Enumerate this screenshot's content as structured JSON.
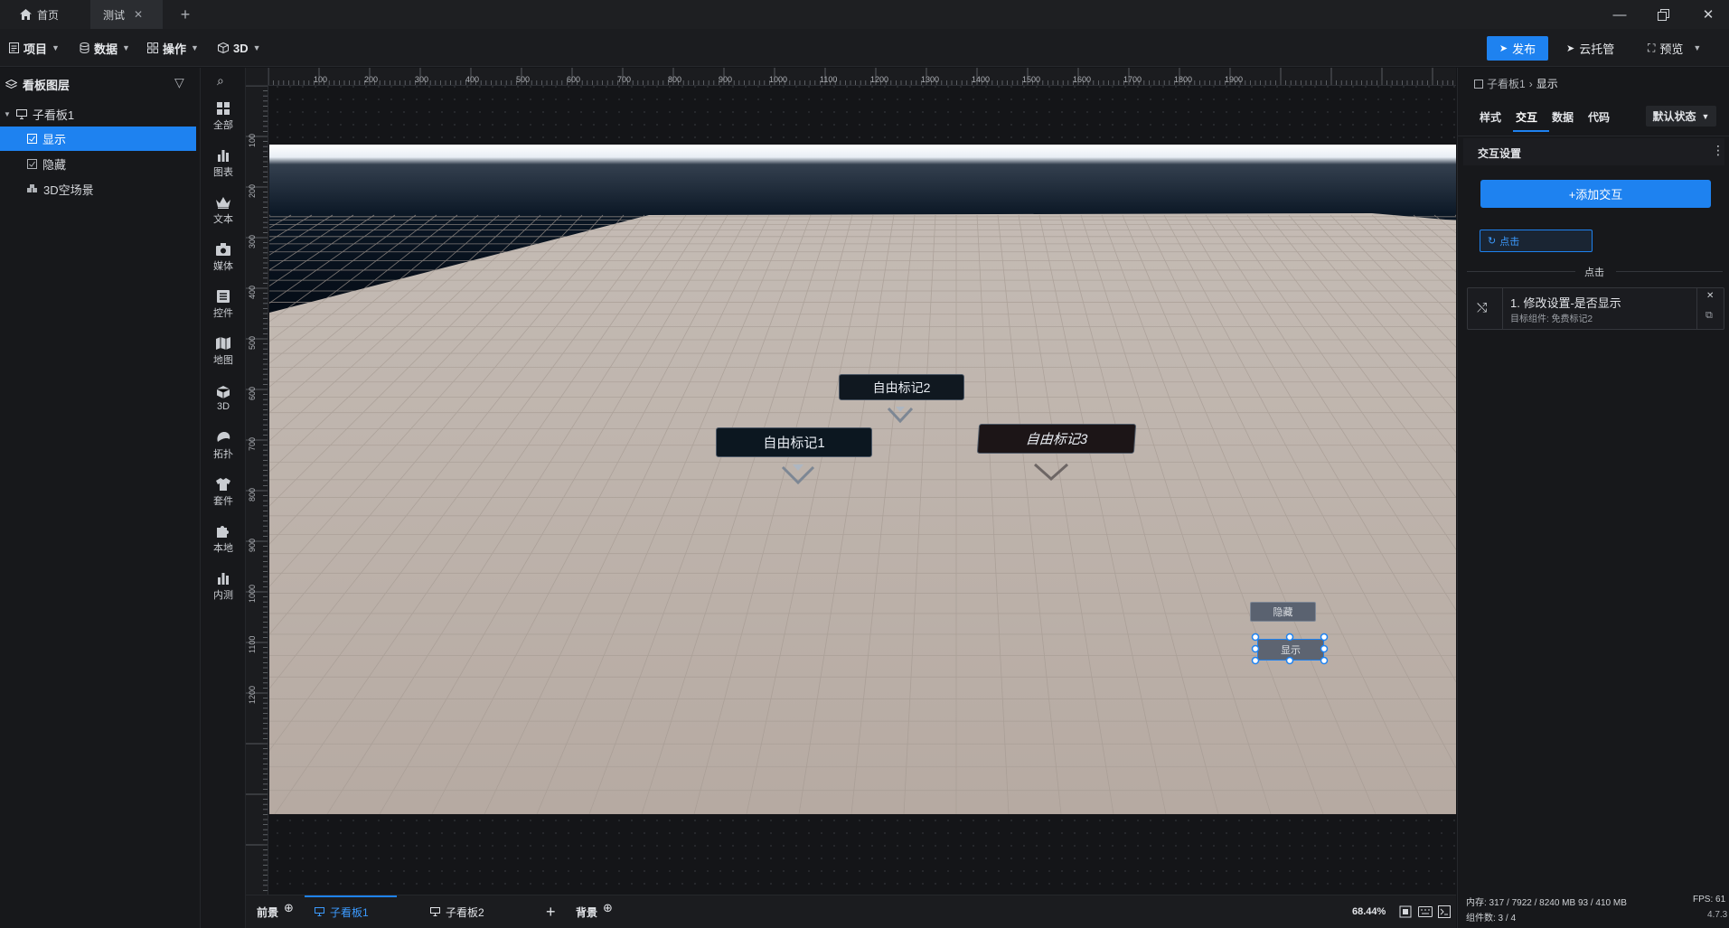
{
  "titlebar": {
    "tabs": [
      {
        "label": "首页",
        "icon": "home-icon"
      },
      {
        "label": "测试",
        "icon": "close-icon"
      }
    ]
  },
  "toolbar": {
    "menus": [
      {
        "label": "项目",
        "icon": "document-icon"
      },
      {
        "label": "数据",
        "icon": "database-icon"
      },
      {
        "label": "操作",
        "icon": "grid-icon"
      },
      {
        "label": "3D",
        "icon": "cube-icon"
      }
    ],
    "publish_label": "发布",
    "cloud_label": "云托管",
    "preview_label": "预览"
  },
  "layers": {
    "title": "看板图层",
    "root": "子看板1",
    "items": [
      {
        "label": "显示",
        "selected": true
      },
      {
        "label": "隐藏",
        "selected": false
      },
      {
        "label": "3D空场景",
        "selected": false
      }
    ]
  },
  "widgets": [
    "全部",
    "图表",
    "文本",
    "媒体",
    "控件",
    "地图",
    "3D",
    "拓扑",
    "套件",
    "本地",
    "内测"
  ],
  "ruler": {
    "top": [
      "100",
      "200",
      "300",
      "400",
      "500",
      "600",
      "700",
      "800",
      "900",
      "1000",
      "1100",
      "1200",
      "1300",
      "1400",
      "1500",
      "1600",
      "1700",
      "1800",
      "1900"
    ],
    "left": [
      "100",
      "200",
      "300",
      "400",
      "500",
      "600",
      "700",
      "800",
      "900",
      "1000",
      "1100",
      "1200"
    ]
  },
  "scene": {
    "markers": [
      "自由标记2",
      "自由标记1",
      "自由标记3"
    ],
    "buttons": {
      "hide": "隐藏",
      "show": "显示"
    }
  },
  "bottombar": {
    "foreground": "前景",
    "boards": [
      "子看板1",
      "子看板2"
    ],
    "background": "背景",
    "zoom": "68.44%"
  },
  "rightpanel": {
    "breadcrumb_parent": "子看板1",
    "breadcrumb_current": "显示",
    "tabs": [
      "样式",
      "交互",
      "数据",
      "代码"
    ],
    "active_tab": "交互",
    "state_select": "默认状态",
    "section_title": "交互设置",
    "add_button": "+添加交互",
    "event_chip": "点击",
    "event_divider": "点击",
    "action_title": "1. 修改设置-是否显示",
    "action_target": "目标组件: 免费标记2",
    "status_memory": "内存: 317 / 7922 / 8240 MB  93 / 410 MB",
    "status_fps": "FPS: 61",
    "status_components": "组件数: 3 / 4",
    "version": "4.7.3"
  },
  "colors": {
    "accent": "#1e82f0",
    "panel": "#17181b",
    "floor": "#bbb0a8"
  }
}
